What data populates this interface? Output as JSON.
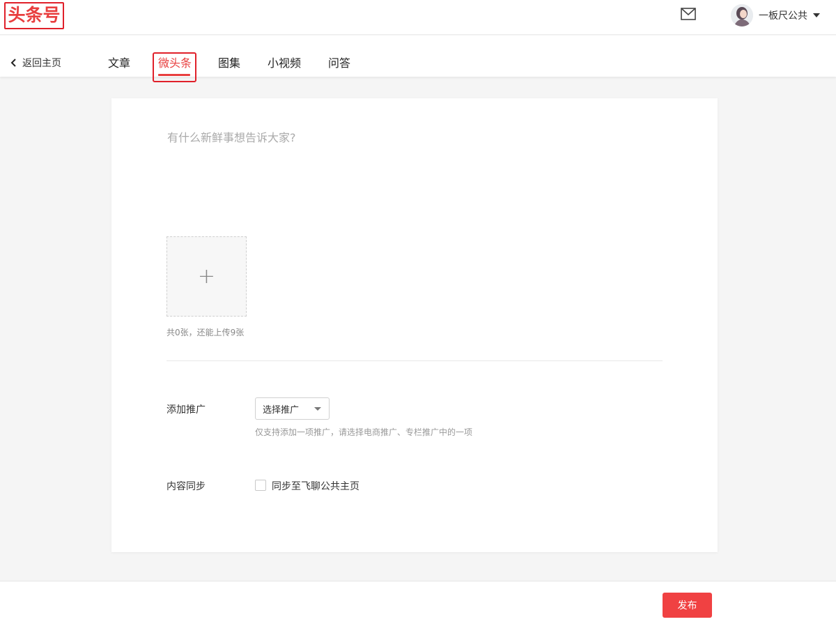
{
  "header": {
    "logo_text": "头条号",
    "icons": {
      "mail": "mail-icon",
      "caret": "caret-down-icon"
    },
    "user": {
      "name": "一板尺公共"
    }
  },
  "nav": {
    "back_label": "返回主页",
    "tabs": [
      {
        "label": "文章",
        "active": false
      },
      {
        "label": "微头条",
        "active": true
      },
      {
        "label": "图集",
        "active": false
      },
      {
        "label": "小视频",
        "active": false
      },
      {
        "label": "问答",
        "active": false
      }
    ]
  },
  "composer": {
    "placeholder": "有什么新鲜事想告诉大家?",
    "upload": {
      "plus": "+",
      "count_text": "共0张，还能上传9张"
    },
    "promotion": {
      "label": "添加推广",
      "select_value": "选择推广",
      "hint": "仅支持添加一项推广，请选择电商推广、专栏推广中的一项"
    },
    "sync": {
      "label": "内容同步",
      "checkbox_label": "同步至飞聊公共主页",
      "checked": false
    }
  },
  "footer": {
    "publish_label": "发布"
  },
  "colors": {
    "accent": "#f04142",
    "active_tab": "#e83e3e",
    "highlight_box": "#e0202a",
    "background": "#f5f5f5"
  }
}
